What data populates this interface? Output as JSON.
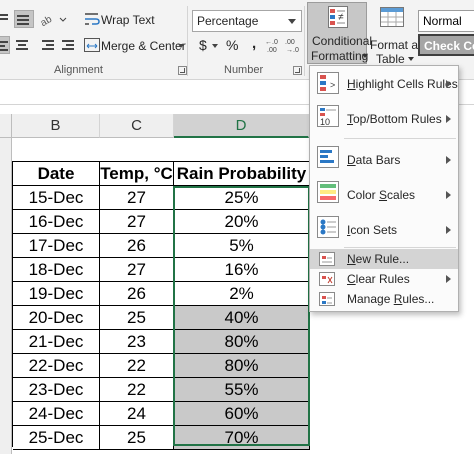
{
  "ribbon": {
    "wrap_text": "Wrap Text",
    "merge_center": "Merge & Center",
    "alignment_label": "Alignment",
    "number_format": "Percentage",
    "currency_symbol": "$",
    "percent_symbol": "%",
    "comma_symbol": ",",
    "number_label": "Number",
    "cf_line1": "Conditional",
    "cf_line2": "Formatting",
    "fat_line1": "Format as",
    "fat_line2": "Table",
    "style_normal": "Normal",
    "style_check_cell": "Check Cell"
  },
  "columns": {
    "b": "B",
    "c": "C",
    "d": "D"
  },
  "table": {
    "header_date": "Date",
    "header_temp": "Temp, °C",
    "header_rain": "Rain Probability",
    "rows": [
      {
        "date": "15-Dec",
        "temp": "27",
        "rain": "25%",
        "highlight": false
      },
      {
        "date": "16-Dec",
        "temp": "27",
        "rain": "20%",
        "highlight": false
      },
      {
        "date": "17-Dec",
        "temp": "26",
        "rain": "5%",
        "highlight": false
      },
      {
        "date": "18-Dec",
        "temp": "27",
        "rain": "16%",
        "highlight": false
      },
      {
        "date": "19-Dec",
        "temp": "26",
        "rain": "2%",
        "highlight": false
      },
      {
        "date": "20-Dec",
        "temp": "25",
        "rain": "40%",
        "highlight": true
      },
      {
        "date": "21-Dec",
        "temp": "23",
        "rain": "80%",
        "highlight": true
      },
      {
        "date": "22-Dec",
        "temp": "22",
        "rain": "80%",
        "highlight": true
      },
      {
        "date": "23-Dec",
        "temp": "22",
        "rain": "55%",
        "highlight": true
      },
      {
        "date": "24-Dec",
        "temp": "24",
        "rain": "60%",
        "highlight": true
      },
      {
        "date": "25-Dec",
        "temp": "25",
        "rain": "70%",
        "highlight": true
      }
    ]
  },
  "menu": {
    "highlight_a": "H",
    "highlight_b": "ighlight Cells Rules",
    "topbottom_a": "T",
    "topbottom_b": "op/Bottom Rules",
    "databars_a": "D",
    "databars_b": "ata Bars",
    "colorscales_a": "Color ",
    "colorscales_s": "S",
    "colorscales_b": "cales",
    "iconsets_a": "I",
    "iconsets_b": "con Sets",
    "newrule_a": "N",
    "newrule_b": "ew Rule...",
    "clearrules_a": "C",
    "clearrules_b": "lear Rules",
    "managerules_a": "Manage ",
    "managerules_r": "R",
    "managerules_b": "ules...",
    "icon_10": "10",
    "icon_gt": ">",
    "icon_neq": "≠"
  },
  "colors": {
    "excel_green": "#217346",
    "highlight_gray": "#c9c9c9"
  }
}
